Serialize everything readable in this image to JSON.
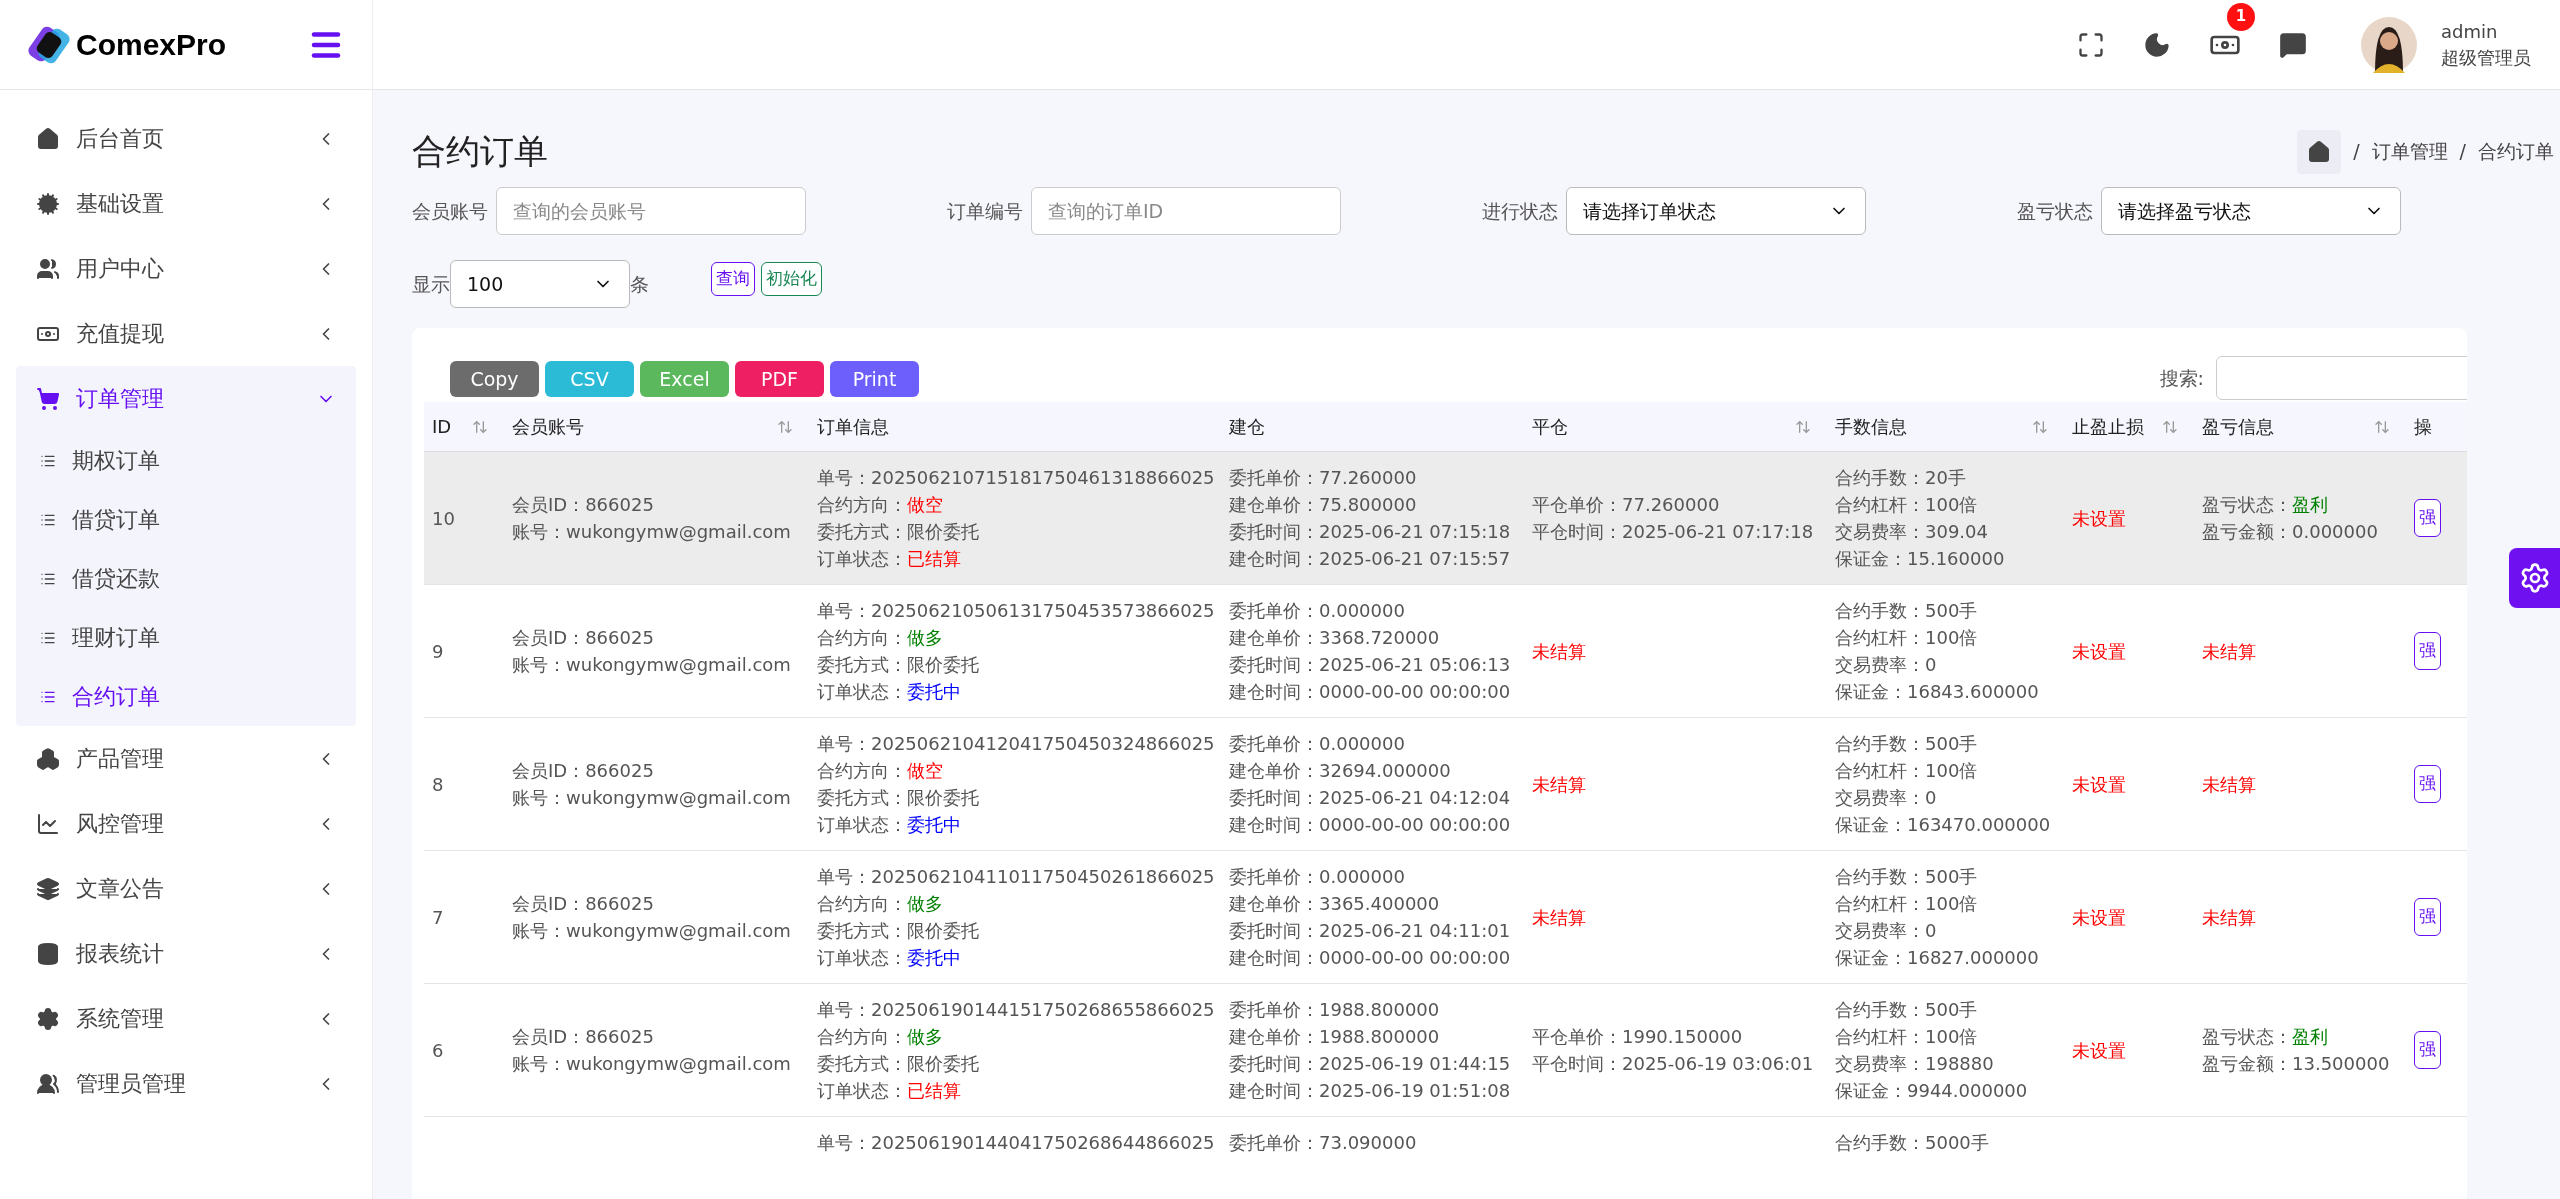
{
  "brand": {
    "name": "ComexPro"
  },
  "sidebar": {
    "items": [
      {
        "label": "后台首页",
        "expanded": false,
        "selected": false
      },
      {
        "label": "基础设置",
        "expanded": false,
        "selected": false
      },
      {
        "label": "用户中心",
        "expanded": false,
        "selected": false
      },
      {
        "label": "充值提现",
        "expanded": false,
        "selected": false
      },
      {
        "label": "订单管理",
        "expanded": true,
        "selected": true,
        "children": [
          {
            "label": "期权订单",
            "selected": false
          },
          {
            "label": "借贷订单",
            "selected": false
          },
          {
            "label": "借贷还款",
            "selected": false
          },
          {
            "label": "理财订单",
            "selected": false
          },
          {
            "label": "合约订单",
            "selected": true
          }
        ]
      },
      {
        "label": "产品管理",
        "expanded": false,
        "selected": false
      },
      {
        "label": "风控管理",
        "expanded": false,
        "selected": false
      },
      {
        "label": "文章公告",
        "expanded": false,
        "selected": false
      },
      {
        "label": "报表统计",
        "expanded": false,
        "selected": false
      },
      {
        "label": "系统管理",
        "expanded": false,
        "selected": false
      },
      {
        "label": "管理员管理",
        "expanded": false,
        "selected": false
      }
    ]
  },
  "topbar": {
    "badge": "1",
    "user": {
      "name": "admin",
      "role": "超级管理员"
    }
  },
  "page": {
    "title": "合约订单",
    "breadcrumb": [
      {
        "separator": "/",
        "label": "订单管理"
      },
      {
        "separator": "/",
        "label": "合约订单"
      }
    ]
  },
  "filters": [
    {
      "label": "会员账号",
      "kind": "input",
      "placeholder": "查询的会员账号"
    },
    {
      "label": "订单编号",
      "kind": "input",
      "placeholder": "查询的订单ID"
    },
    {
      "label": "进行状态",
      "kind": "select",
      "value": "请选择订单状态"
    },
    {
      "label": "盈亏状态",
      "kind": "select",
      "value": "请选择盈亏状态"
    }
  ],
  "page_size": {
    "label": "显示",
    "value": "100",
    "suffix": "条"
  },
  "actions": [
    {
      "label": "查询",
      "color": "#6610f2"
    },
    {
      "label": "初始化",
      "color": "#198754"
    }
  ],
  "export_buttons": [
    {
      "label": "Copy",
      "color": "#6c6c6c"
    },
    {
      "label": "CSV",
      "color": "#2bbbd7"
    },
    {
      "label": "Excel",
      "color": "#5cb85c"
    },
    {
      "label": "PDF",
      "color": "#ee1f62"
    },
    {
      "label": "Print",
      "color": "#6c5ffc"
    }
  ],
  "search": {
    "label": "搜索:"
  },
  "table": {
    "columns": [
      {
        "label": "ID",
        "sortable": true
      },
      {
        "label": "会员账号",
        "sortable": true
      },
      {
        "label": "订单信息",
        "sortable": false
      },
      {
        "label": "建仓",
        "sortable": false
      },
      {
        "label": "平仓",
        "sortable": true
      },
      {
        "label": "手数信息",
        "sortable": true
      },
      {
        "label": "止盈止损",
        "sortable": true
      },
      {
        "label": "盈亏信息",
        "sortable": true
      },
      {
        "label": "操",
        "sortable": false
      }
    ],
    "rows": [
      {
        "kind": "full",
        "selected": true,
        "id": "10",
        "member": [
          "会员ID：866025",
          "账号：wukongymw@gmail.com"
        ],
        "order": [
          {
            "label": "单号：",
            "value": "202506210715181750461318866025"
          },
          {
            "label": "合约方向：",
            "value": "做空",
            "color": "#ff0000"
          },
          {
            "label": "委托方式：",
            "value": "限价委托"
          },
          {
            "label": "订单状态：",
            "value": "已结算",
            "color": "#ff0000"
          }
        ],
        "open": [
          {
            "label": "委托单价：",
            "value": "77.260000"
          },
          {
            "label": "建仓单价：",
            "value": "75.800000"
          },
          {
            "label": "委托时间：",
            "value": "2025-06-21 07:15:18"
          },
          {
            "label": "建仓时间：",
            "value": "2025-06-21 07:15:57"
          }
        ],
        "close": [
          {
            "label": "平仓单价：",
            "value": "77.260000"
          },
          {
            "label": "平仓时间：",
            "value": "2025-06-21 07:17:18"
          }
        ],
        "lots": [
          {
            "label": "合约手数：",
            "value": "20手"
          },
          {
            "label": "合约杠杆：",
            "value": "100倍"
          },
          {
            "label": "交易费率：",
            "value": "309.04"
          },
          {
            "label": "保证金：",
            "value": "15.160000"
          }
        ],
        "stop": [
          {
            "value": "未设置",
            "color": "#ff0000"
          }
        ],
        "pnl": [
          {
            "label": "盈亏状态：",
            "value": "盈利",
            "color": "#008000"
          },
          {
            "label": "盈亏金额：",
            "value": "0.000000"
          }
        ],
        "action": "强"
      },
      {
        "kind": "full",
        "selected": false,
        "id": "9",
        "member": [
          "会员ID：866025",
          "账号：wukongymw@gmail.com"
        ],
        "order": [
          {
            "label": "单号：",
            "value": "202506210506131750453573866025"
          },
          {
            "label": "合约方向：",
            "value": "做多",
            "color": "#008000"
          },
          {
            "label": "委托方式：",
            "value": "限价委托"
          },
          {
            "label": "订单状态：",
            "value": "委托中",
            "color": "#0000ff"
          }
        ],
        "open": [
          {
            "label": "委托单价：",
            "value": "0.000000"
          },
          {
            "label": "建仓单价：",
            "value": "3368.720000"
          },
          {
            "label": "委托时间：",
            "value": "2025-06-21 05:06:13"
          },
          {
            "label": "建仓时间：",
            "value": "0000-00-00 00:00:00"
          }
        ],
        "close": [
          {
            "value": "未结算",
            "color": "#ff0000"
          }
        ],
        "lots": [
          {
            "label": "合约手数：",
            "value": "500手"
          },
          {
            "label": "合约杠杆：",
            "value": "100倍"
          },
          {
            "label": "交易费率：",
            "value": "0"
          },
          {
            "label": "保证金：",
            "value": "16843.600000"
          }
        ],
        "stop": [
          {
            "value": "未设置",
            "color": "#ff0000"
          }
        ],
        "pnl": [
          {
            "value": "未结算",
            "color": "#ff0000"
          }
        ],
        "action": "强"
      },
      {
        "kind": "full",
        "selected": false,
        "id": "8",
        "member": [
          "会员ID：866025",
          "账号：wukongymw@gmail.com"
        ],
        "order": [
          {
            "label": "单号：",
            "value": "202506210412041750450324866025"
          },
          {
            "label": "合约方向：",
            "value": "做空",
            "color": "#ff0000"
          },
          {
            "label": "委托方式：",
            "value": "限价委托"
          },
          {
            "label": "订单状态：",
            "value": "委托中",
            "color": "#0000ff"
          }
        ],
        "open": [
          {
            "label": "委托单价：",
            "value": "0.000000"
          },
          {
            "label": "建仓单价：",
            "value": "32694.000000"
          },
          {
            "label": "委托时间：",
            "value": "2025-06-21 04:12:04"
          },
          {
            "label": "建仓时间：",
            "value": "0000-00-00 00:00:00"
          }
        ],
        "close": [
          {
            "value": "未结算",
            "color": "#ff0000"
          }
        ],
        "lots": [
          {
            "label": "合约手数：",
            "value": "500手"
          },
          {
            "label": "合约杠杆：",
            "value": "100倍"
          },
          {
            "label": "交易费率：",
            "value": "0"
          },
          {
            "label": "保证金：",
            "value": "163470.000000"
          }
        ],
        "stop": [
          {
            "value": "未设置",
            "color": "#ff0000"
          }
        ],
        "pnl": [
          {
            "value": "未结算",
            "color": "#ff0000"
          }
        ],
        "action": "强"
      },
      {
        "kind": "full",
        "selected": false,
        "id": "7",
        "member": [
          "会员ID：866025",
          "账号：wukongymw@gmail.com"
        ],
        "order": [
          {
            "label": "单号：",
            "value": "202506210411011750450261866025"
          },
          {
            "label": "合约方向：",
            "value": "做多",
            "color": "#008000"
          },
          {
            "label": "委托方式：",
            "value": "限价委托"
          },
          {
            "label": "订单状态：",
            "value": "委托中",
            "color": "#0000ff"
          }
        ],
        "open": [
          {
            "label": "委托单价：",
            "value": "0.000000"
          },
          {
            "label": "建仓单价：",
            "value": "3365.400000"
          },
          {
            "label": "委托时间：",
            "value": "2025-06-21 04:11:01"
          },
          {
            "label": "建仓时间：",
            "value": "0000-00-00 00:00:00"
          }
        ],
        "close": [
          {
            "value": "未结算",
            "color": "#ff0000"
          }
        ],
        "lots": [
          {
            "label": "合约手数：",
            "value": "500手"
          },
          {
            "label": "合约杠杆：",
            "value": "100倍"
          },
          {
            "label": "交易费率：",
            "value": "0"
          },
          {
            "label": "保证金：",
            "value": "16827.000000"
          }
        ],
        "stop": [
          {
            "value": "未设置",
            "color": "#ff0000"
          }
        ],
        "pnl": [
          {
            "value": "未结算",
            "color": "#ff0000"
          }
        ],
        "action": "强"
      },
      {
        "kind": "full",
        "selected": false,
        "id": "6",
        "member": [
          "会员ID：866025",
          "账号：wukongymw@gmail.com"
        ],
        "order": [
          {
            "label": "单号：",
            "value": "202506190144151750268655866025"
          },
          {
            "label": "合约方向：",
            "value": "做多",
            "color": "#008000"
          },
          {
            "label": "委托方式：",
            "value": "限价委托"
          },
          {
            "label": "订单状态：",
            "value": "已结算",
            "color": "#ff0000"
          }
        ],
        "open": [
          {
            "label": "委托单价：",
            "value": "1988.800000"
          },
          {
            "label": "建仓单价：",
            "value": "1988.800000"
          },
          {
            "label": "委托时间：",
            "value": "2025-06-19 01:44:15"
          },
          {
            "label": "建仓时间：",
            "value": "2025-06-19 01:51:08"
          }
        ],
        "close": [
          {
            "label": "平仓单价：",
            "value": "1990.150000"
          },
          {
            "label": "平仓时间：",
            "value": "2025-06-19 03:06:01"
          }
        ],
        "lots": [
          {
            "label": "合约手数：",
            "value": "500手"
          },
          {
            "label": "合约杠杆：",
            "value": "100倍"
          },
          {
            "label": "交易费率：",
            "value": "198880"
          },
          {
            "label": "保证金：",
            "value": "9944.000000"
          }
        ],
        "stop": [
          {
            "value": "未设置",
            "color": "#ff0000"
          }
        ],
        "pnl": [
          {
            "label": "盈亏状态：",
            "value": "盈利",
            "color": "#008000"
          },
          {
            "label": "盈亏金额：",
            "value": "13.500000"
          }
        ],
        "action": "强"
      },
      {
        "kind": "cut",
        "selected": false,
        "member": [],
        "order": [
          {
            "label": "单号：",
            "value": "202506190144041750268644866025"
          }
        ],
        "open": [
          {
            "label": "委托单价：",
            "value": "73.090000"
          }
        ],
        "close": [],
        "lots": [
          {
            "label": "合约手数：",
            "value": "5000手"
          }
        ],
        "stop": [],
        "pnl": []
      }
    ]
  }
}
